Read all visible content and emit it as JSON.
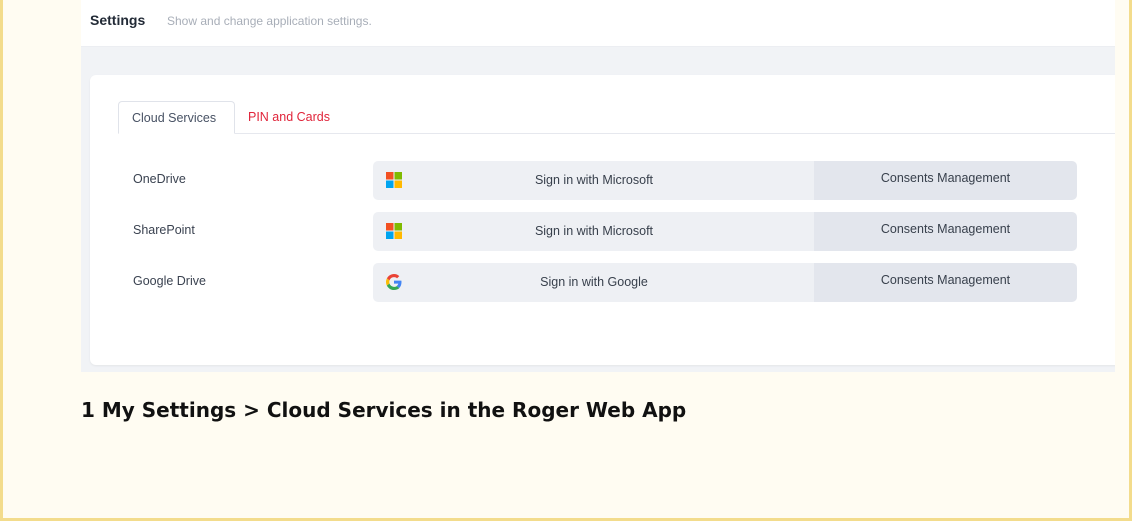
{
  "header": {
    "title": "Settings",
    "subtitle": "Show and change application settings."
  },
  "tabs": [
    {
      "label": "Cloud Services",
      "active": true
    },
    {
      "label": "PIN and Cards",
      "active": false,
      "color": "#e0243a"
    }
  ],
  "services": [
    {
      "name": "OneDrive",
      "signin_label": "Sign in with Microsoft",
      "provider_icon": "microsoft-logo-icon",
      "consent_label": "Consents Management"
    },
    {
      "name": "SharePoint",
      "signin_label": "Sign in with Microsoft",
      "provider_icon": "microsoft-logo-icon",
      "consent_label": "Consents Management"
    },
    {
      "name": "Google Drive",
      "signin_label": "Sign in with Google",
      "provider_icon": "google-logo-icon",
      "consent_label": "Consents Management"
    }
  ],
  "caption": "1 My Settings > Cloud Services in the Roger Web App",
  "colors": {
    "accent_red": "#e0243a",
    "ms_red": "#f25022",
    "ms_green": "#7fba00",
    "ms_blue": "#00a4ef",
    "ms_yellow": "#ffb900"
  }
}
